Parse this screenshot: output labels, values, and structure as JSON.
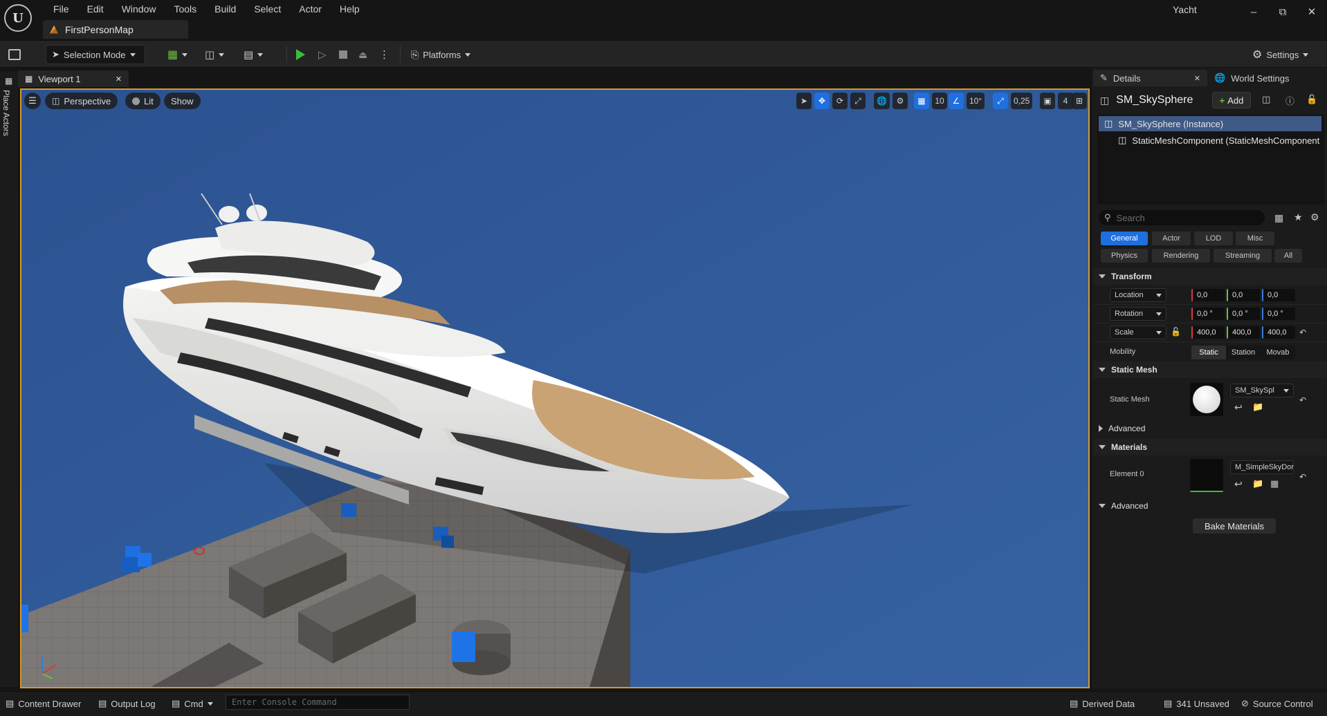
{
  "app": {
    "menu": [
      "File",
      "Edit",
      "Window",
      "Tools",
      "Build",
      "Select",
      "Actor",
      "Help"
    ],
    "document_tab": "FirstPersonMap",
    "project": "Yacht"
  },
  "toolbar": {
    "selection_mode": "Selection Mode",
    "platforms": "Platforms",
    "settings": "Settings"
  },
  "left_strip": {
    "place_actors": "Place Actors"
  },
  "viewport": {
    "tab_label": "Viewport 1",
    "perspective": "Perspective",
    "lit": "Lit",
    "show": "Show",
    "grid_snap": "10",
    "rotation_snap": "10°",
    "scale_snap": "0,25",
    "camera_speed": "4"
  },
  "details": {
    "tab_details": "Details",
    "tab_world_settings": "World Settings",
    "actor_name": "SM_SkySphere",
    "add_label": "Add",
    "components": [
      "SM_SkySphere (Instance)",
      "StaticMeshComponent (StaticMeshComponent"
    ],
    "search_placeholder": "Search",
    "filters": [
      "General",
      "Actor",
      "LOD",
      "Misc",
      "Physics",
      "Rendering",
      "Streaming",
      "All"
    ],
    "transform": {
      "header": "Transform",
      "location_label": "Location",
      "rotation_label": "Rotation",
      "scale_label": "Scale",
      "location": [
        "0,0",
        "0,0",
        "0,0"
      ],
      "rotation": [
        "0,0 °",
        "0,0 °",
        "0,0 °"
      ],
      "scale": [
        "400,0",
        "400,0",
        "400,0"
      ],
      "mobility_label": "Mobility",
      "mobility_options": [
        "Static",
        "Station",
        "Movab"
      ]
    },
    "static_mesh": {
      "header": "Static Mesh",
      "label": "Static Mesh",
      "value": "SM_SkySpl"
    },
    "advanced_1": "Advanced",
    "materials": {
      "header": "Materials",
      "element_label": "Element 0",
      "value": "M_SimpleSkyDor"
    },
    "advanced_2": "Advanced",
    "bake_button": "Bake Materials"
  },
  "statusbar": {
    "content_drawer": "Content Drawer",
    "output_log": "Output Log",
    "cmd": "Cmd",
    "console_placeholder": "Enter Console Command",
    "derived_data": "Derived Data",
    "unsaved": "341 Unsaved",
    "source_control": "Source Control"
  },
  "colors": {
    "accent_blue": "#1f6fe0",
    "viewport_border": "#d69a2c",
    "sky": "#2f5794",
    "play_green": "#3bbf3b"
  }
}
